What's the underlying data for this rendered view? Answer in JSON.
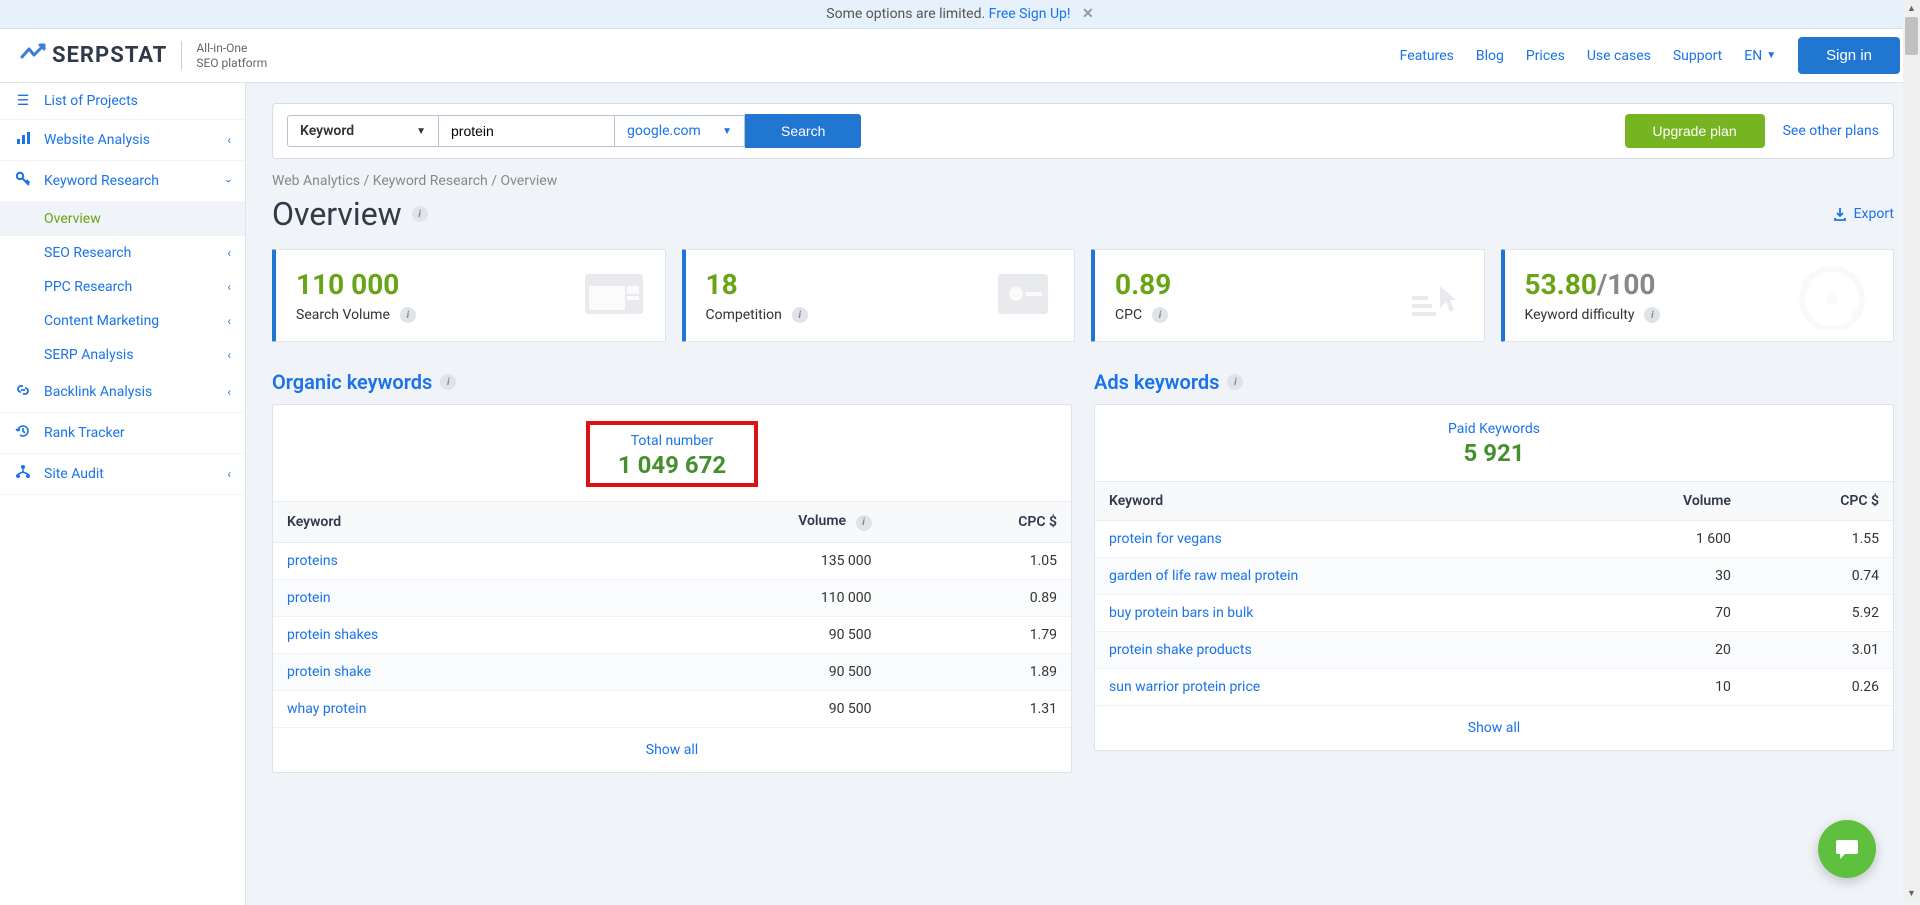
{
  "banner": {
    "text": "Some options are limited.",
    "link": "Free Sign Up!"
  },
  "logo": {
    "name": "SERPSTAT",
    "sub1": "All-in-One",
    "sub2": "SEO platform"
  },
  "header_nav": {
    "features": "Features",
    "blog": "Blog",
    "prices": "Prices",
    "use_cases": "Use cases",
    "support": "Support",
    "lang": "EN",
    "signin": "Sign in"
  },
  "sidebar": {
    "projects": "List of Projects",
    "website": "Website Analysis",
    "keyword": "Keyword Research",
    "sub": {
      "overview": "Overview",
      "seo": "SEO Research",
      "ppc": "PPC Research",
      "content": "Content Marketing",
      "serp": "SERP Analysis"
    },
    "backlink": "Backlink Analysis",
    "rank": "Rank Tracker",
    "audit": "Site Audit"
  },
  "search": {
    "type": "Keyword",
    "value": "protein",
    "engine": "google.com",
    "btn": "Search",
    "upgrade": "Upgrade plan",
    "other": "See other plans"
  },
  "breadcrumb": "Web Analytics / Keyword Research / Overview",
  "page_title": "Overview",
  "export": "Export",
  "cards": {
    "volume": {
      "value": "110 000",
      "label": "Search Volume"
    },
    "competition": {
      "value": "18",
      "label": "Competition"
    },
    "cpc": {
      "value": "0.89",
      "label": "CPC"
    },
    "difficulty": {
      "value": "53.80",
      "suffix": "/100",
      "label": "Keyword difficulty"
    }
  },
  "organic": {
    "title": "Organic keywords",
    "total_label": "Total number",
    "total_value": "1 049 672",
    "cols": {
      "kw": "Keyword",
      "vol": "Volume",
      "cpc": "CPC $"
    },
    "rows": [
      {
        "kw": "proteins",
        "vol": "135 000",
        "cpc": "1.05"
      },
      {
        "kw": "protein",
        "vol": "110 000",
        "cpc": "0.89"
      },
      {
        "kw": "protein shakes",
        "vol": "90 500",
        "cpc": "1.79"
      },
      {
        "kw": "protein shake",
        "vol": "90 500",
        "cpc": "1.89"
      },
      {
        "kw": "whay protein",
        "vol": "90 500",
        "cpc": "1.31"
      }
    ],
    "show_all": "Show all"
  },
  "ads": {
    "title": "Ads keywords",
    "total_label": "Paid Keywords",
    "total_value": "5 921",
    "cols": {
      "kw": "Keyword",
      "vol": "Volume",
      "cpc": "CPC $"
    },
    "rows": [
      {
        "kw": "protein for vegans",
        "vol": "1 600",
        "cpc": "1.55"
      },
      {
        "kw": "garden of life raw meal protein",
        "vol": "30",
        "cpc": "0.74"
      },
      {
        "kw": "buy protein bars in bulk",
        "vol": "70",
        "cpc": "5.92"
      },
      {
        "kw": "protein shake products",
        "vol": "20",
        "cpc": "3.01"
      },
      {
        "kw": "sun warrior protein price",
        "vol": "10",
        "cpc": "0.26"
      }
    ],
    "show_all": "Show all"
  }
}
